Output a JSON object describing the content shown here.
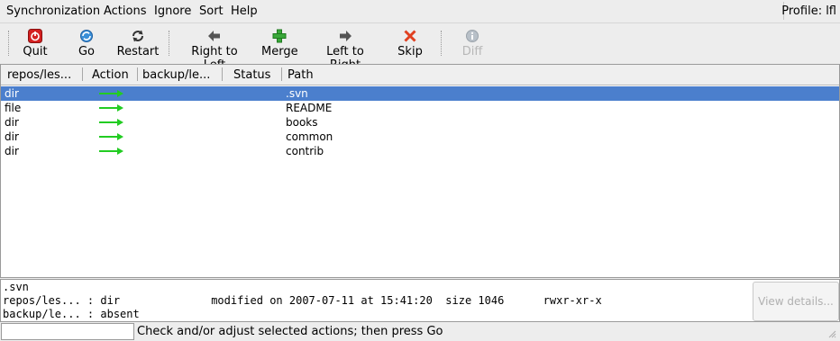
{
  "menubar": {
    "items": [
      "Synchronization",
      "Actions",
      "Ignore",
      "Sort",
      "Help"
    ],
    "profile": "Profile: lfl"
  },
  "toolbar": {
    "quit": "Quit",
    "go": "Go",
    "restart": "Restart",
    "right_to_left": "Right to Left",
    "merge": "Merge",
    "left_to_right": "Left to Right",
    "skip": "Skip",
    "diff": "Diff"
  },
  "list": {
    "columns": [
      "repos/les...",
      "Action",
      "backup/le...",
      "Status",
      "Path"
    ],
    "rows": [
      {
        "left": "dir",
        "action": "right-arrow",
        "right": "",
        "status": "",
        "path": ".svn",
        "selected": true
      },
      {
        "left": "file",
        "action": "right-arrow",
        "right": "",
        "status": "",
        "path": "README",
        "selected": false
      },
      {
        "left": "dir",
        "action": "right-arrow",
        "right": "",
        "status": "",
        "path": "books",
        "selected": false
      },
      {
        "left": "dir",
        "action": "right-arrow",
        "right": "",
        "status": "",
        "path": "common",
        "selected": false
      },
      {
        "left": "dir",
        "action": "right-arrow",
        "right": "",
        "status": "",
        "path": "contrib",
        "selected": false
      }
    ]
  },
  "details": {
    "path": ".svn",
    "left_line": "repos/les... : dir              modified on 2007-07-11 at 15:41:20  size 1046      rwxr-xr-x",
    "right_line": "backup/le... : absent",
    "view_details": "View details..."
  },
  "status": {
    "input_value": "",
    "message": "Check and/or adjust selected actions; then press Go"
  },
  "colors": {
    "selection": "#4b7fcd",
    "arrow": "#22cc22",
    "quit_red": "#d42020",
    "go_blue": "#3a8fd8",
    "merge_green": "#3aa83a",
    "skip_red": "#e04020"
  }
}
